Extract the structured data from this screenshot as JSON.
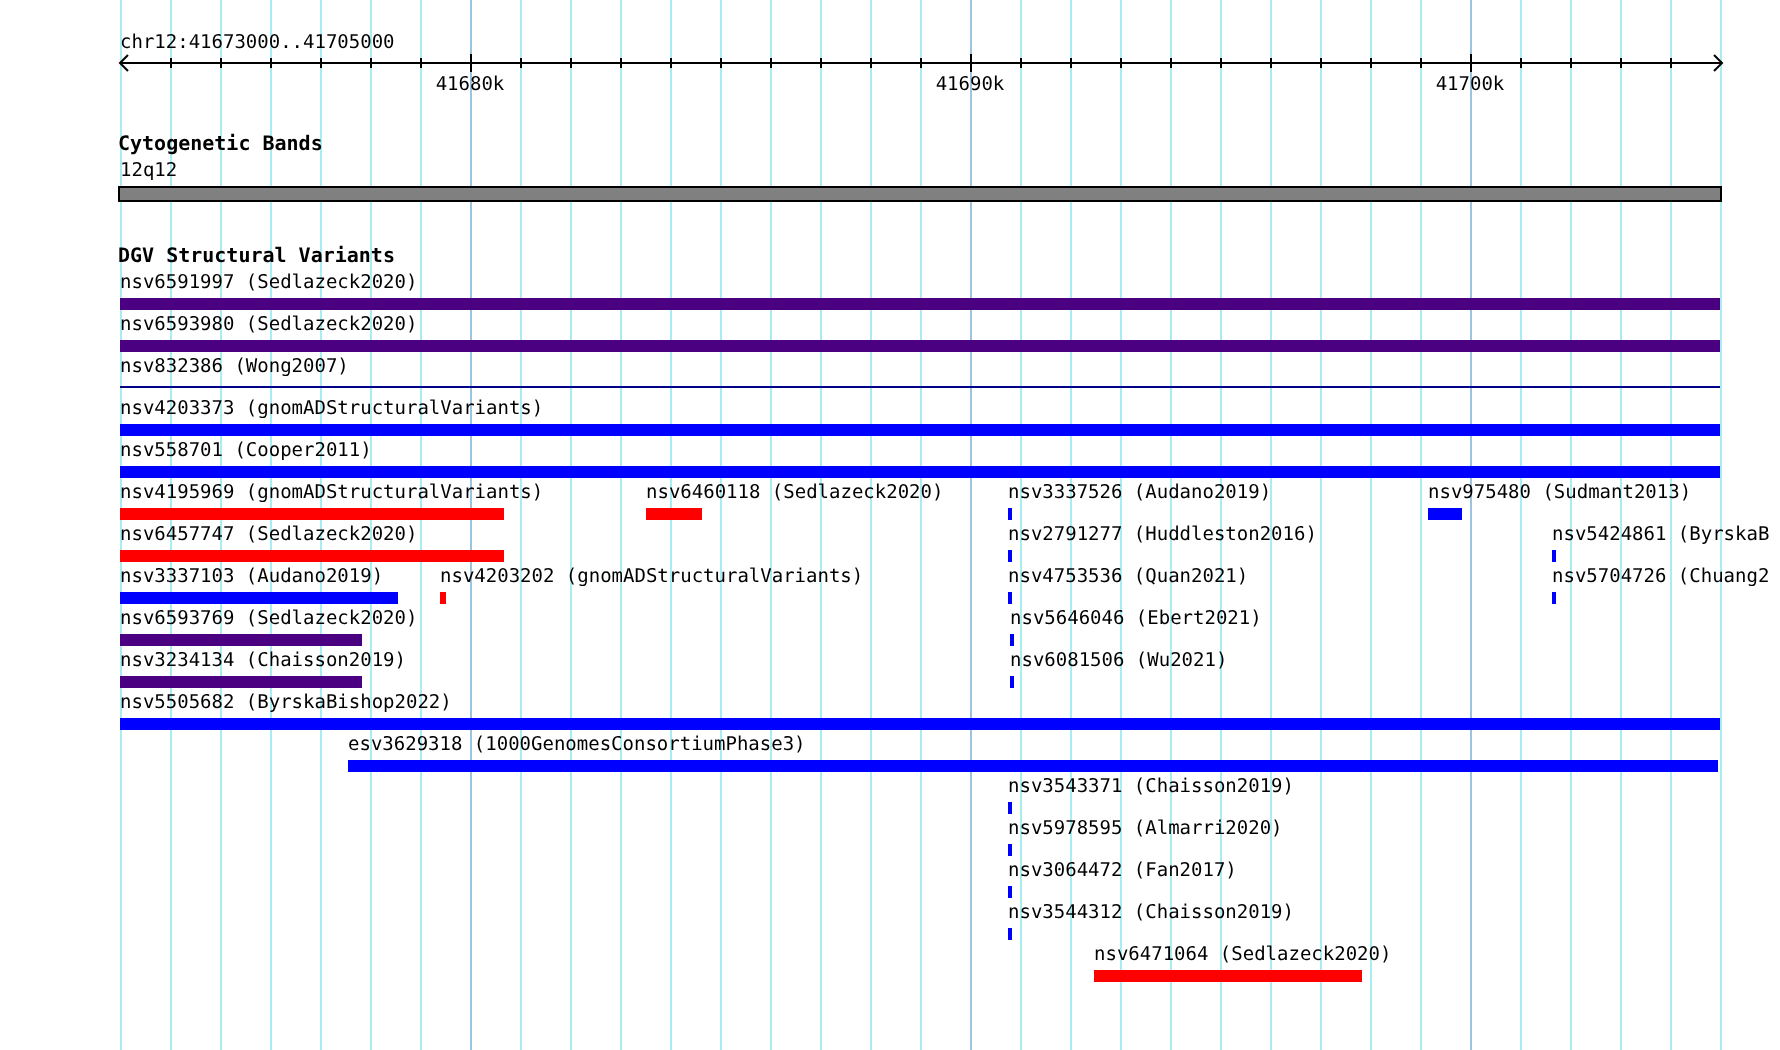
{
  "ruler": {
    "label": "chr12:41673000..41705000",
    "ticks": [
      {
        "label": "41680k"
      },
      {
        "label": "41690k"
      },
      {
        "label": "41700k"
      }
    ]
  },
  "tracks": [
    {
      "kind": "bands",
      "title": "Cytogenetic Bands",
      "features": [
        {
          "label": "12q12",
          "color": "#808080"
        }
      ]
    },
    {
      "kind": "variants",
      "title": "DGV Structural Variants",
      "features": [
        {
          "label": "nsv6591997 (Sedlazeck2020)",
          "color": "#4b0082",
          "kind": "bar"
        },
        {
          "label": "nsv6593980 (Sedlazeck2020)",
          "color": "#4b0082",
          "kind": "bar"
        },
        {
          "label": "nsv832386 (Wong2007)",
          "color": "#00008b",
          "kind": "line"
        },
        {
          "label": "nsv4203373 (gnomADStructuralVariants)",
          "color": "#0000ff",
          "kind": "bar"
        },
        {
          "label": "nsv558701 (Cooper2011)",
          "color": "#0000ff",
          "kind": "bar"
        },
        {
          "label": "nsv4195969 (gnomADStructuralVariants)",
          "color": "#ff0000",
          "kind": "bar"
        },
        {
          "label": "nsv6460118 (Sedlazeck2020)",
          "color": "#ff0000",
          "kind": "bar"
        },
        {
          "label": "nsv3337526 (Audano2019)",
          "color": "#0000ff",
          "kind": "bar"
        },
        {
          "label": "nsv975480 (Sudmant2013)",
          "color": "#0000ff",
          "kind": "bar"
        },
        {
          "label": "nsv6457747 (Sedlazeck2020)",
          "color": "#ff0000",
          "kind": "bar"
        },
        {
          "label": "nsv2791277 (Huddleston2016)",
          "color": "#0000ff",
          "kind": "bar"
        },
        {
          "label": "nsv5424861 (ByrskaB",
          "color": "#0000ff",
          "kind": "bar"
        },
        {
          "label": "nsv3337103 (Audano2019)",
          "color": "#0000ff",
          "kind": "bar"
        },
        {
          "label": "nsv4203202 (gnomADStructuralVariants)",
          "color": "#ff0000",
          "kind": "bar"
        },
        {
          "label": "nsv4753536 (Quan2021)",
          "color": "#0000ff",
          "kind": "bar"
        },
        {
          "label": "nsv5704726 (Chuang2",
          "color": "#0000ff",
          "kind": "bar"
        },
        {
          "label": "nsv6593769 (Sedlazeck2020)",
          "color": "#4b0082",
          "kind": "bar"
        },
        {
          "label": "nsv5646046 (Ebert2021)",
          "color": "#0000ff",
          "kind": "bar"
        },
        {
          "label": "nsv3234134 (Chaisson2019)",
          "color": "#4b0082",
          "kind": "bar"
        },
        {
          "label": "nsv6081506 (Wu2021)",
          "color": "#0000ff",
          "kind": "bar"
        },
        {
          "label": "nsv5505682 (ByrskaBishop2022)",
          "color": "#0000ff",
          "kind": "bar"
        },
        {
          "label": "esv3629318 (1000GenomesConsortiumPhase3)",
          "color": "#0000ff",
          "kind": "bar"
        },
        {
          "label": "nsv3543371 (Chaisson2019)",
          "color": "#0000ff",
          "kind": "bar"
        },
        {
          "label": "nsv5978595 (Almarri2020)",
          "color": "#0000ff",
          "kind": "bar"
        },
        {
          "label": "nsv3064472 (Fan2017)",
          "color": "#0000ff",
          "kind": "bar"
        },
        {
          "label": "nsv3544312 (Chaisson2019)",
          "color": "#0000ff",
          "kind": "bar"
        },
        {
          "label": "nsv6471064 (Sedlazeck2020)",
          "color": "#ff0000",
          "kind": "bar"
        }
      ]
    }
  ]
}
